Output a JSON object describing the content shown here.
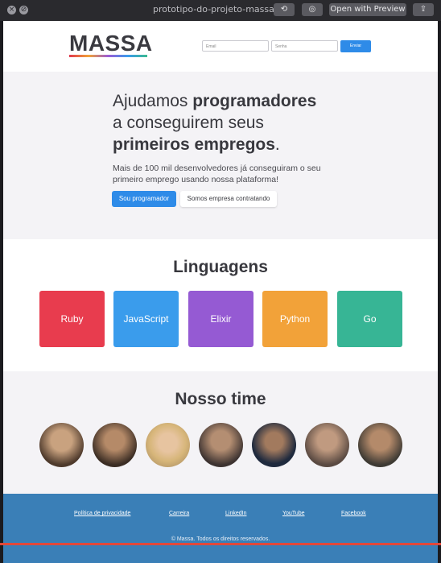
{
  "window": {
    "title": "prototipo-do-projeto-massa.png",
    "open_with_preview": "Open with Preview"
  },
  "header": {
    "logo": "MASSA",
    "email_placeholder": "Email",
    "password_placeholder": "Senha",
    "submit_label": "Enviar"
  },
  "hero": {
    "line1_regular": "Ajudamos ",
    "line1_bold": "programadores",
    "line2": "a conseguirem seus",
    "line3_bold": "primeiros empregos",
    "line3_end": ".",
    "subtitle": "Mais de 100 mil desenvolvedores já conseguiram o seu primeiro emprego usando nossa plataforma!",
    "cta_primary": "Sou programador",
    "cta_secondary": "Somos empresa contratando"
  },
  "languages": {
    "title": "Linguagens",
    "items": [
      {
        "label": "Ruby",
        "color": "#e83c4e"
      },
      {
        "label": "JavaScript",
        "color": "#3a9cec"
      },
      {
        "label": "Elixir",
        "color": "#955ad3"
      },
      {
        "label": "Python",
        "color": "#f2a239"
      },
      {
        "label": "Go",
        "color": "#37b595"
      }
    ]
  },
  "team": {
    "title": "Nosso time",
    "members": [
      {
        "icon": "avatar-photo"
      },
      {
        "icon": "avatar-photo"
      },
      {
        "icon": "avatar-photo"
      },
      {
        "icon": "avatar-photo"
      },
      {
        "icon": "avatar-photo"
      },
      {
        "icon": "avatar-photo"
      },
      {
        "icon": "avatar-photo"
      }
    ]
  },
  "footer": {
    "links": [
      "Política de privacidade",
      "Carreira",
      "LinkedIn",
      "YouTube",
      "Facebook"
    ],
    "copyright": "© Massa. Todos os direitos reservados."
  }
}
